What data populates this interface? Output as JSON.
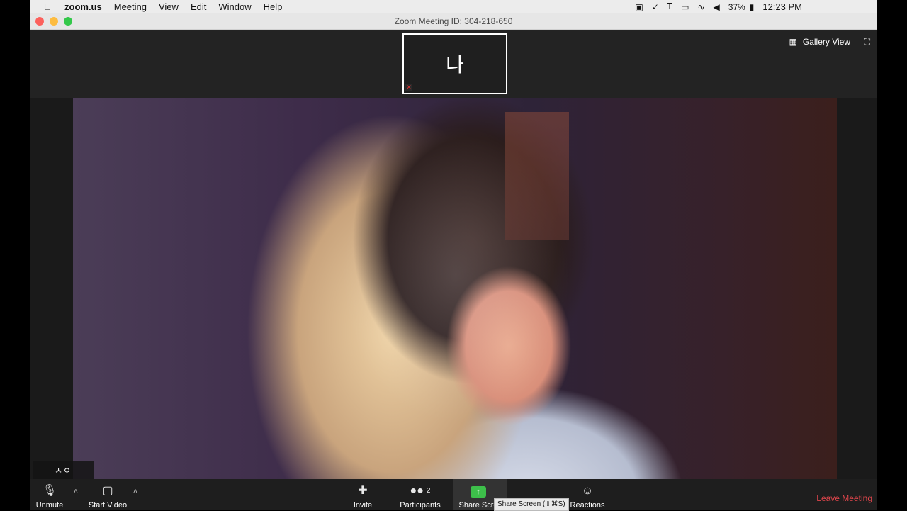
{
  "menubar": {
    "app_name": "zoom.us",
    "items": [
      "Meeting",
      "View",
      "Edit",
      "Window",
      "Help"
    ],
    "battery": "37%",
    "clock": "12:23 PM"
  },
  "window": {
    "title": "Zoom Meeting ID: 304-218-650"
  },
  "thumbnail": {
    "name": "나",
    "mic_muted": true
  },
  "view_controls": {
    "gallery_label": "Gallery View"
  },
  "video": {
    "caption_text": "ㅅㅇ"
  },
  "toolbar": {
    "unmute_label": "Unmute",
    "start_video_label": "Start Video",
    "invite_label": "Invite",
    "participants_label": "Participants",
    "participants_count": "2",
    "share_label": "Share Scre",
    "share_tooltip": "Share Screen (⇧⌘S)",
    "reactions_label": "Reactions",
    "leave_label": "Leave Meeting"
  },
  "colors": {
    "leave": "#e0464c",
    "share_green": "#3dbf4a",
    "muted_red": "#e03030"
  }
}
